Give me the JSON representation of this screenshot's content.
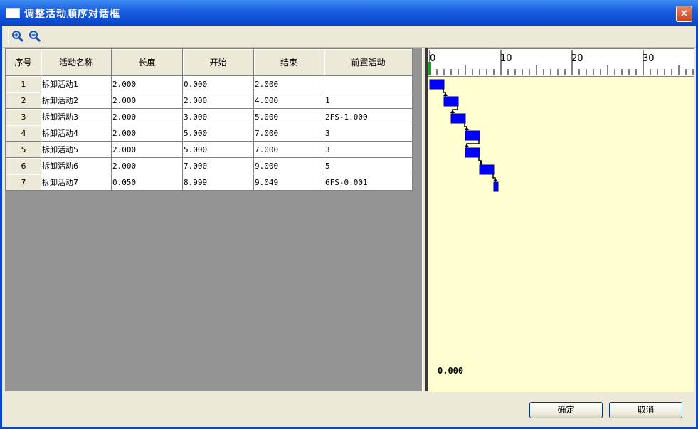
{
  "window": {
    "title": "调整活动顺序对话框",
    "title_bar_color": "#0a4bd0"
  },
  "toolbar": {
    "zoom_in_icon": "zoom-in-icon",
    "zoom_out_icon": "zoom-out-icon"
  },
  "grid": {
    "columns": [
      "序号",
      "活动名称",
      "长度",
      "开始",
      "结束",
      "前置活动"
    ],
    "rows": [
      [
        "1",
        "拆卸活动1",
        "2.000",
        "0.000",
        "2.000",
        ""
      ],
      [
        "2",
        "拆卸活动2",
        "2.000",
        "2.000",
        "4.000",
        "1"
      ],
      [
        "3",
        "拆卸活动3",
        "2.000",
        "3.000",
        "5.000",
        "2FS-1.000"
      ],
      [
        "4",
        "拆卸活动4",
        "2.000",
        "5.000",
        "7.000",
        "3"
      ],
      [
        "5",
        "拆卸活动5",
        "2.000",
        "5.000",
        "7.000",
        "3"
      ],
      [
        "6",
        "拆卸活动6",
        "2.000",
        "7.000",
        "9.000",
        "5"
      ],
      [
        "7",
        "拆卸活动7",
        "0.050",
        "8.999",
        "9.049",
        "6FS-0.001"
      ]
    ]
  },
  "gantt": {
    "ruler_labels": [
      "0",
      "10",
      "20",
      "30"
    ],
    "value_display": "0.000",
    "bar_color": "#0000ff",
    "background_color": "#ffffd2",
    "tasks": [
      {
        "start": 0,
        "end": 2
      },
      {
        "start": 2,
        "end": 4
      },
      {
        "start": 3,
        "end": 5
      },
      {
        "start": 5,
        "end": 7
      },
      {
        "start": 5,
        "end": 7
      },
      {
        "start": 7,
        "end": 9
      },
      {
        "start": 8.999,
        "end": 9.049
      }
    ]
  },
  "footer": {
    "ok_label": "确定",
    "cancel_label": "取消"
  }
}
